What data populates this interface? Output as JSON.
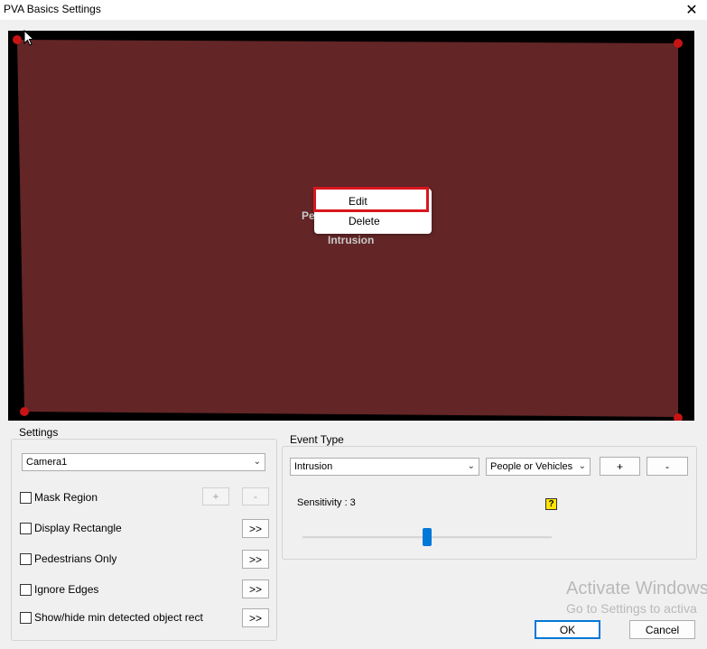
{
  "window": {
    "title": "PVA Basics Settings",
    "close_icon": "close-icon"
  },
  "video": {
    "region_color": "#632526",
    "corner_color": "#c81414",
    "label_partial": "Pe",
    "label_event": "Intrusion"
  },
  "context_menu": {
    "items": [
      {
        "label": "Edit",
        "highlighted": true
      },
      {
        "label": "Delete",
        "highlighted": false
      }
    ],
    "highlight_color": "#d9161e"
  },
  "settings": {
    "legend": "Settings",
    "camera": "Camera1",
    "options": [
      {
        "label": "Mask Region",
        "checked": false
      },
      {
        "label": "Display Rectangle",
        "checked": false
      },
      {
        "label": "Pedestrians Only",
        "checked": false
      },
      {
        "label": "Ignore Edges",
        "checked": false
      },
      {
        "label": "Show/hide min detected object rect",
        "checked": false
      }
    ],
    "plus_label": "+",
    "minus_label": "-",
    "more_label": ">>"
  },
  "event_type": {
    "legend": "Event Type",
    "event_value": "Intrusion",
    "target_value": "People or Vehicles",
    "add_label": "+",
    "remove_label": "-",
    "sensitivity_label": "Sensitivity : 3",
    "sensitivity_value": 3,
    "help_icon_glyph": "?"
  },
  "watermark": {
    "line1": "Activate Windows",
    "line2": "Go to Settings to activa"
  },
  "footer": {
    "ok_label": "OK",
    "cancel_label": "Cancel"
  }
}
